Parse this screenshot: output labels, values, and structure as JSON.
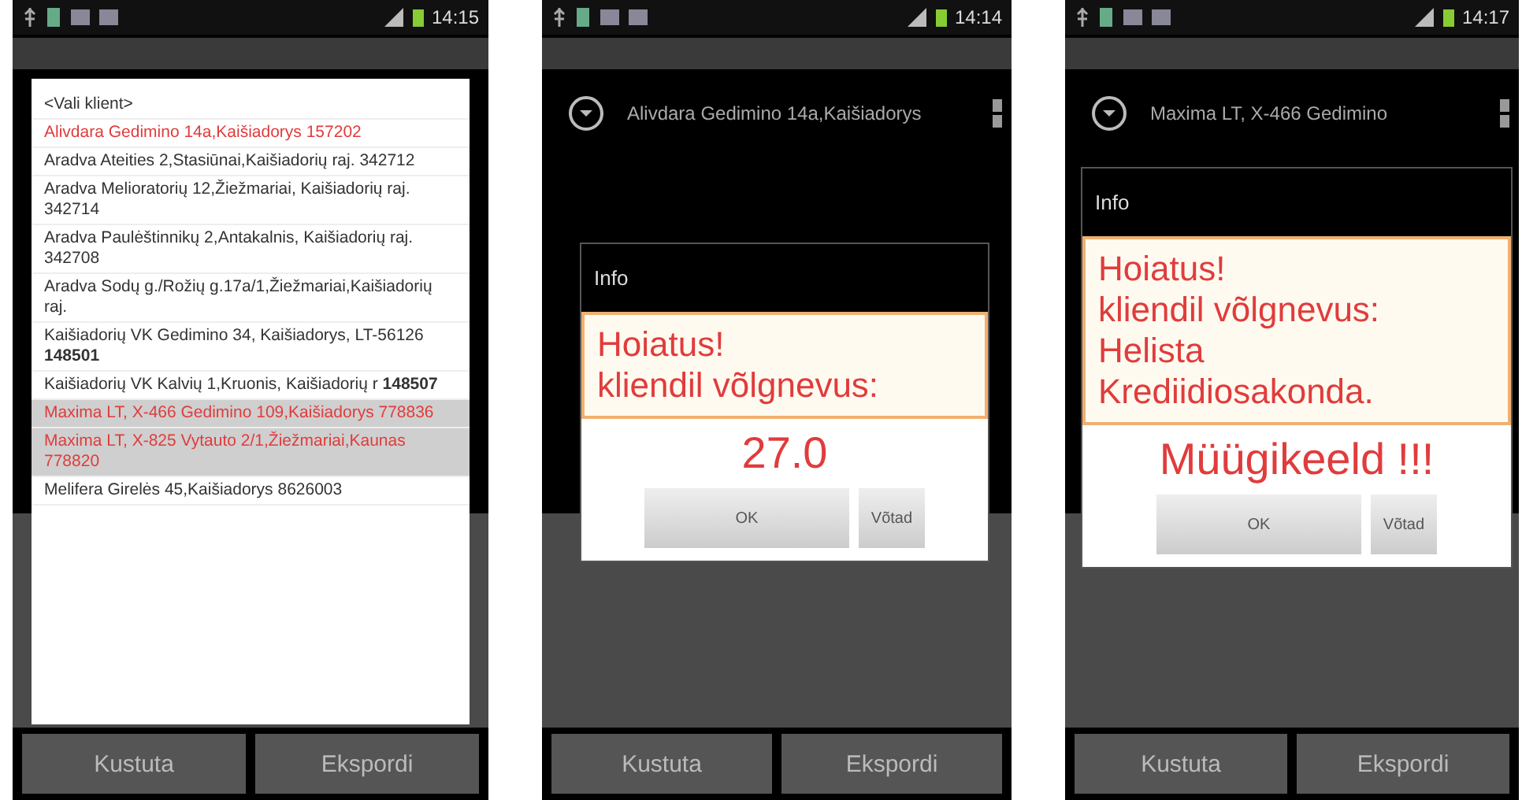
{
  "phones": [
    {
      "kind": "client_list",
      "status_time": "14:15",
      "list": {
        "items": [
          {
            "text": "<Vali klient>",
            "color": "#333333",
            "highlighted": false
          },
          {
            "text": "Alivdara Gedimino 14a,Kaišiadorys 157202",
            "color": "#e03c3c",
            "highlighted": false
          },
          {
            "text": "Aradva Ateities 2,Stasiūnai,Kaišiadorių raj. 342712",
            "color": "#333333",
            "highlighted": false
          },
          {
            "text": "Aradva Melioratorių 12,Žiežmariai, Kaišiadorių raj. 342714",
            "color": "#333333",
            "highlighted": false
          },
          {
            "text": "Aradva Paulėštinnikų 2,Antakalnis, Kaišiadorių raj. 342708",
            "color": "#333333",
            "highlighted": false
          },
          {
            "text": "Aradva Sodų g./Rožių g.17a/1,Žiežmariai,Kaišiadorių raj.",
            "color": "#333333",
            "highlighted": false
          },
          {
            "text": "Kaišiadorių VK Gedimino 34, Kaišiadorys, LT-56126 **148501**",
            "color": "#333333",
            "highlighted": false
          },
          {
            "text": "Kaišiadorių VK Kalvių 1,Kruonis, Kaišiadorių r **148507**",
            "color": "#333333",
            "highlighted": false
          },
          {
            "text": "Maxima LT, X-466 Gedimino 109,Kaišiadorys 778836",
            "color": "#e03c3c",
            "highlighted": true
          },
          {
            "text": "Maxima LT, X-825 Vytauto 2/1,Žiežmariai,Kaunas 778820",
            "color": "#e03c3c",
            "highlighted": true
          },
          {
            "text": "Melifera Girelės 45,Kaišiadorys 8626003",
            "color": "#333333",
            "highlighted": false
          }
        ]
      },
      "buttons": [
        "Kustuta",
        "Ekspordi"
      ]
    },
    {
      "kind": "alert",
      "status_time": "14:14",
      "header": {
        "client": "Alivdara Gedimino 14a,Kaišiadorys"
      },
      "dialog": {
        "title": "Info",
        "message": [
          "Hoiatus!",
          "kliendil võlgnevus:"
        ],
        "detail": "27.0",
        "buttons": [
          "OK",
          "Võtad"
        ]
      },
      "buttons": [
        "Kustuta",
        "Ekspordi"
      ]
    },
    {
      "kind": "alert",
      "status_time": "14:17",
      "header": {
        "client": "Maxima LT, X-466 Gedimino"
      },
      "dialog": {
        "title": "Info",
        "message": [
          "Hoiatus!",
          "kliendil võlgnevus:",
          "Helista",
          "Krediidiosakonda."
        ],
        "detail": "Müügikeeld !!!",
        "buttons": [
          "OK",
          "Võtad"
        ]
      },
      "buttons": [
        "Kustuta",
        "Ekspordi"
      ]
    }
  ]
}
